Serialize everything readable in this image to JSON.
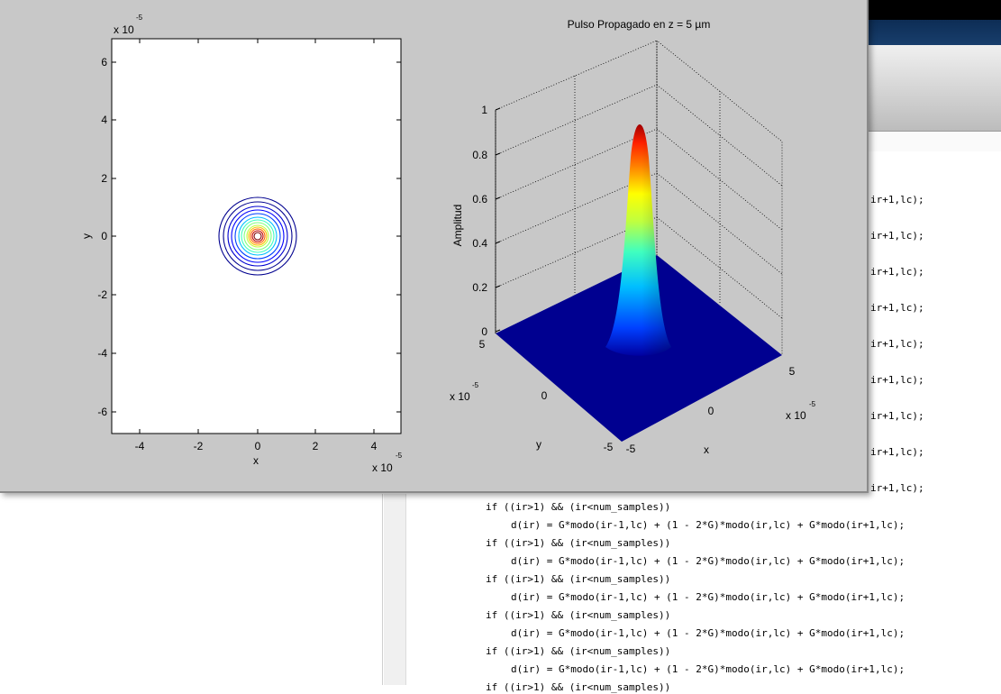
{
  "editor": {
    "right_fragments": [
      "ir+1,lc);",
      "ir+1,lc);",
      "ir+1,lc);",
      "ir+1,lc);",
      "ir+1,lc);",
      "ir+1,lc);",
      "ir+1,lc);",
      "ir+1,lc);",
      "ir+1,lc);"
    ],
    "code_lines": [
      {
        "indent": false,
        "text": "if ((ir>1) && (ir<num_samples))"
      },
      {
        "indent": true,
        "text": "d(ir) = G*modo(ir-1,lc) + (1 - 2*G)*modo(ir,lc) + G*modo(ir+1,lc);"
      },
      {
        "indent": false,
        "text": "if ((ir>1) && (ir<num_samples))"
      },
      {
        "indent": true,
        "text": "d(ir) = G*modo(ir-1,lc) + (1 - 2*G)*modo(ir,lc) + G*modo(ir+1,lc);"
      },
      {
        "indent": false,
        "text": "if ((ir>1) && (ir<num_samples))"
      },
      {
        "indent": true,
        "text": "d(ir) = G*modo(ir-1,lc) + (1 - 2*G)*modo(ir,lc) + G*modo(ir+1,lc);"
      },
      {
        "indent": false,
        "text": "if ((ir>1) && (ir<num_samples))"
      },
      {
        "indent": true,
        "text": "d(ir) = G*modo(ir-1,lc) + (1 - 2*G)*modo(ir,lc) + G*modo(ir+1,lc);"
      },
      {
        "indent": false,
        "text": "if ((ir>1) && (ir<num_samples))"
      },
      {
        "indent": true,
        "text": "d(ir) = G*modo(ir-1,lc) + (1 - 2*G)*modo(ir,lc) + G*modo(ir+1,lc);"
      },
      {
        "indent": false,
        "text": "if ((ir>1) && (ir<num_samples))"
      }
    ]
  },
  "figure": {
    "contour_plot": {
      "exponent_label": "x 10",
      "exponent_sup": "-5",
      "xlabel": "x",
      "ylabel": "y",
      "xticks": [
        "-4",
        "-2",
        "0",
        "2",
        "4"
      ],
      "yticks": [
        "6",
        "4",
        "2",
        "0",
        "-2",
        "-4",
        "-6"
      ],
      "x_exponent_label": "x 10",
      "x_exponent_sup": "-5",
      "colors": [
        "#00008f",
        "#0000ff",
        "#00bfff",
        "#7fffff",
        "#bfff3f",
        "#ffbf00",
        "#ff3f00",
        "#bf0000",
        "#800000"
      ]
    },
    "surface_plot": {
      "title": "Pulso Propagado en z =   5 µm",
      "zlabel": "Amplitud",
      "xlabel": "x",
      "ylabel": "y",
      "zticks": [
        "1",
        "0.8",
        "0.6",
        "0.4",
        "0.2",
        "0"
      ],
      "y_ticks": [
        "5",
        "0",
        "-5"
      ],
      "x_ticks": [
        "-5",
        "0",
        "5"
      ],
      "y_exponent_label": "x 10",
      "y_exponent_sup": "-5",
      "x_exponent_label": "x 10",
      "x_exponent_sup": "-5",
      "colormap": "jet"
    }
  }
}
